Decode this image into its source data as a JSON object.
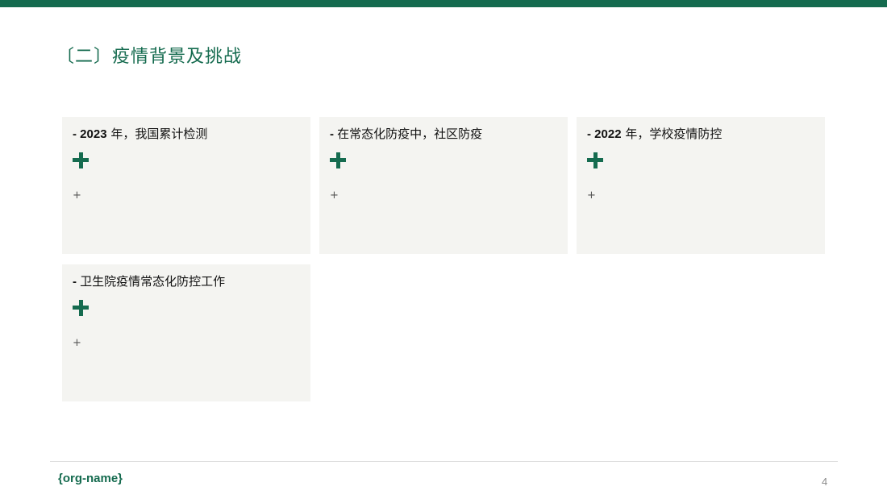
{
  "title": "〔二〕疫情背景及挑战",
  "cards": [
    {
      "prefix": "- ",
      "year": "2023",
      "text": " 年，我国累计检测",
      "plus_big": "+",
      "plus_small": "+"
    },
    {
      "prefix": "-  ",
      "year": "",
      "text": "在常态化防疫中，社区防疫",
      "plus_big": "+",
      "plus_small": "+"
    },
    {
      "prefix": "- ",
      "year": "2022",
      "text": " 年，学校疫情防控",
      "plus_big": "+",
      "plus_small": "+"
    },
    {
      "prefix": "-  ",
      "year": "",
      "text": "卫生院疫情常态化防控工作",
      "plus_big": "+",
      "plus_small": "+"
    }
  ],
  "footer": {
    "org": "{org-name}",
    "page": "4"
  },
  "colors": {
    "accent": "#156b4f",
    "card_bg": "#f4f4f1"
  }
}
